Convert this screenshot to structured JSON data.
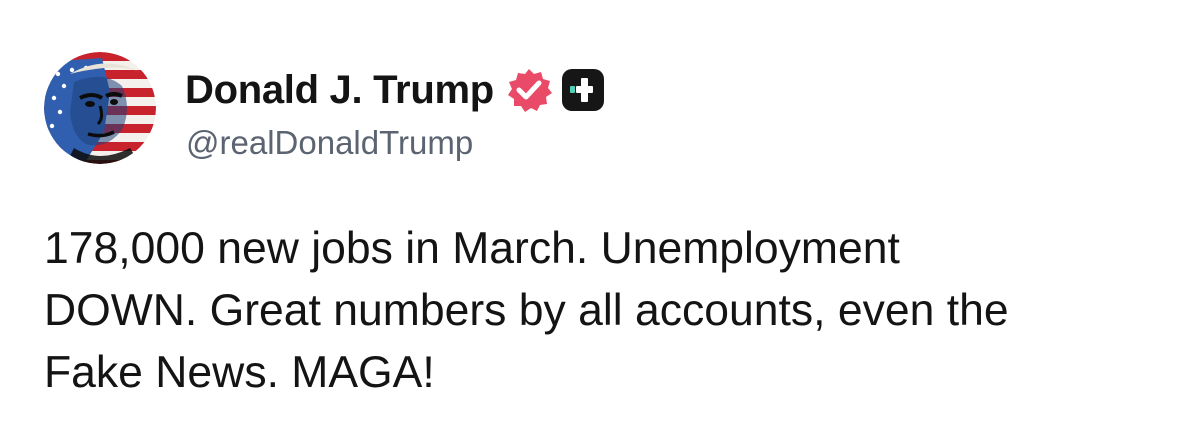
{
  "author": {
    "display_name": "Donald J. Trump",
    "handle": "@realDonaldTrump",
    "avatar_icon": "avatar-flag-portrait",
    "badges": [
      "verified-check-icon",
      "app-logo-icon"
    ]
  },
  "post": {
    "lines": [
      "178,000 new jobs in March. Unemployment",
      "DOWN. Great numbers by all accounts, even the",
      "Fake News. MAGA!"
    ]
  },
  "colors": {
    "verified_badge": "#e84a67",
    "app_logo_bg": "#161616",
    "app_logo_accent": "#4fd1b7",
    "handle_text": "#5b6470"
  }
}
